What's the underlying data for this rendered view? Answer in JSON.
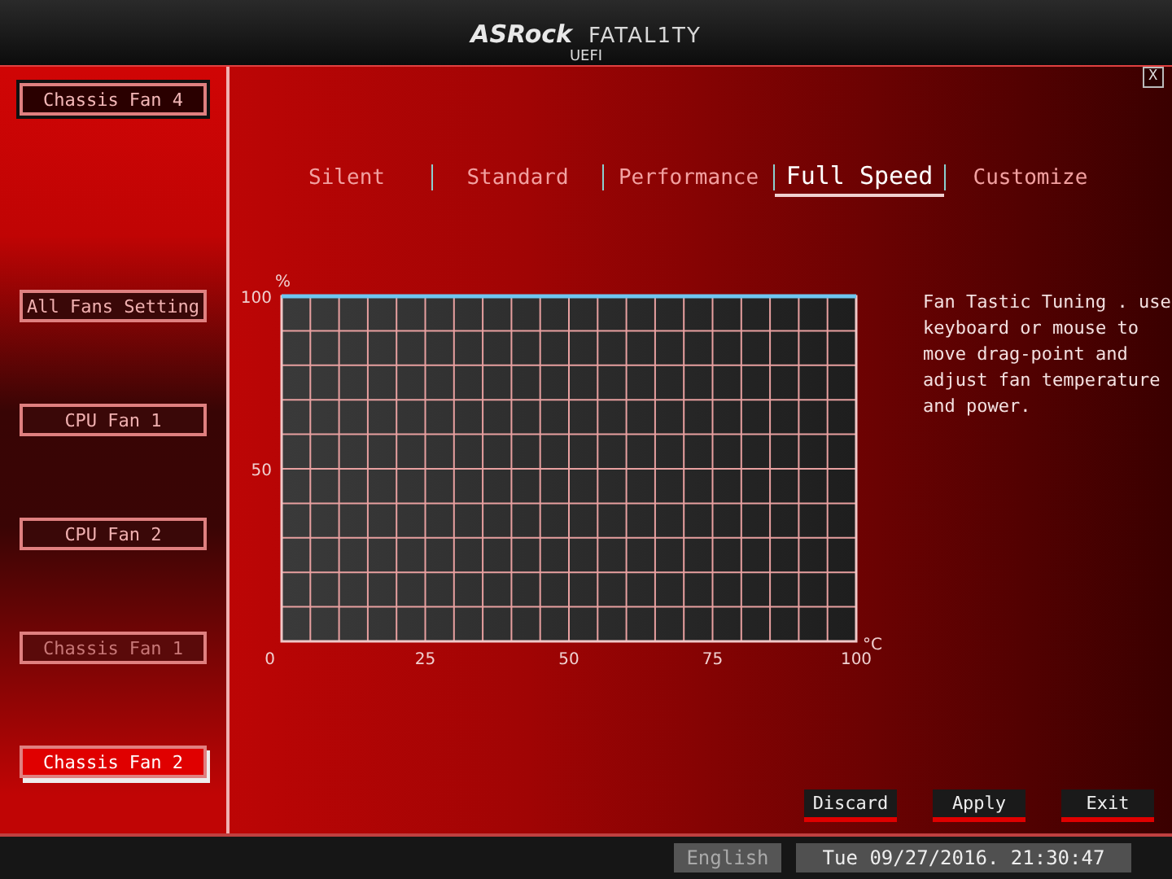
{
  "header": {
    "logo": "ASRock",
    "brand": "FATAL1TY",
    "subtitle": "UEFI"
  },
  "close_button": "X",
  "fan_selector": {
    "label": "Chassis Fan 4"
  },
  "fans": [
    {
      "label": "All Fans Setting",
      "selected": false,
      "disabled": false
    },
    {
      "label": "CPU Fan 1",
      "selected": false,
      "disabled": false
    },
    {
      "label": "CPU Fan 2",
      "selected": false,
      "disabled": false
    },
    {
      "label": "Chassis Fan 1",
      "selected": false,
      "disabled": true
    },
    {
      "label": "Chassis Fan 2",
      "selected": true,
      "disabled": false
    }
  ],
  "tabs": [
    {
      "label": "Silent",
      "selected": false
    },
    {
      "label": "Standard",
      "selected": false
    },
    {
      "label": "Performance",
      "selected": false
    },
    {
      "label": "Full Speed",
      "selected": true
    },
    {
      "label": "Customize",
      "selected": false
    }
  ],
  "chart": {
    "chart_data": {
      "type": "line",
      "xlabel": "°C",
      "ylabel": "%",
      "x": [
        0,
        100
      ],
      "series": [
        {
          "color": "#6ec6f0",
          "values": [
            100,
            100
          ]
        }
      ],
      "grid": true,
      "xlim": [
        0,
        100
      ],
      "ylim": [
        0,
        100
      ],
      "xticks": [
        0,
        25,
        50,
        75,
        100
      ],
      "yticks": [
        50,
        100
      ]
    }
  },
  "help_text": "Fan Tastic Tuning . use keyboard or mouse to move drag-point and adjust fan temperature and power.",
  "buttons": [
    "Discard",
    "Apply",
    "Exit"
  ],
  "status_bar": {
    "language": "English",
    "datetime": "Tue 09/27/2016. 21:30:47"
  }
}
